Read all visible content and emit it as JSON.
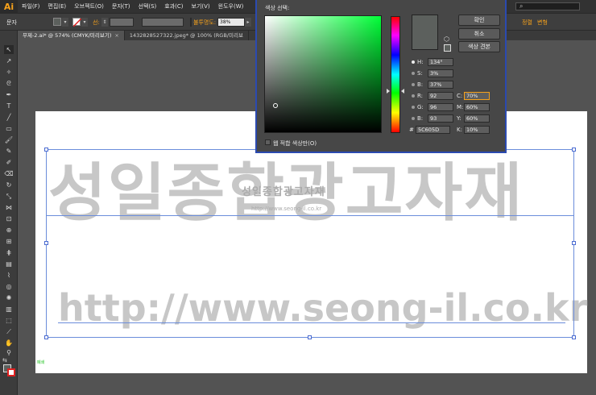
{
  "app": {
    "logo": "Ai"
  },
  "menu": {
    "items": [
      "파일(F)",
      "편집(E)",
      "오브젝트(O)",
      "문자(T)",
      "선택(S)",
      "효과(C)",
      "보기(V)",
      "윈도우(W)"
    ],
    "search_icon": "⌕"
  },
  "control_bar": {
    "selection_label": "문자",
    "stroke_label": "선:",
    "opacity_label": "불투명도:",
    "opacity_value": "38%",
    "align_label": "정렬",
    "transform_label": "변형"
  },
  "tabs": [
    {
      "label": "무제-2.ai* @ 574% (CMYK/미리보기)",
      "close": "×",
      "active": true
    },
    {
      "label": "1432828527322.jpeg* @ 100% (RGB/미리보",
      "close": "",
      "active": false
    }
  ],
  "artwork": {
    "big_text": "성일종합광고자재",
    "url_text": "http://www.seong-il.co.kr",
    "small_name": "성일종합광고자재",
    "small_url": "http://www.seong-il.co.kr",
    "status_label": "폐쇄"
  },
  "color_picker": {
    "title": "색상 선택:",
    "ok_label": "확인",
    "cancel_label": "취소",
    "swatches_label": "색상 견본",
    "preview_color": "#5c605d",
    "fields_left": [
      {
        "label": "H:",
        "value": "134°",
        "selected": true
      },
      {
        "label": "S:",
        "value": "3%",
        "selected": false
      },
      {
        "label": "B:",
        "value": "37%",
        "selected": false
      },
      {
        "label": "R:",
        "value": "92",
        "selected": false
      },
      {
        "label": "G:",
        "value": "96",
        "selected": false
      },
      {
        "label": "B:",
        "value": "93",
        "selected": false
      }
    ],
    "fields_right": [
      {
        "label": "C:",
        "value": "70%"
      },
      {
        "label": "M:",
        "value": "60%"
      },
      {
        "label": "Y:",
        "value": "60%"
      },
      {
        "label": "K:",
        "value": "10%"
      }
    ],
    "hex_label": "#",
    "hex_value": "5C605D",
    "websafe_label": "웹 적합 색상만(O)"
  },
  "colors": {
    "accent": "#f7a21b",
    "selection": "#6b8ddb",
    "dialog_border": "#2b4ab0",
    "artwork_gray": "#c7c7c7"
  }
}
